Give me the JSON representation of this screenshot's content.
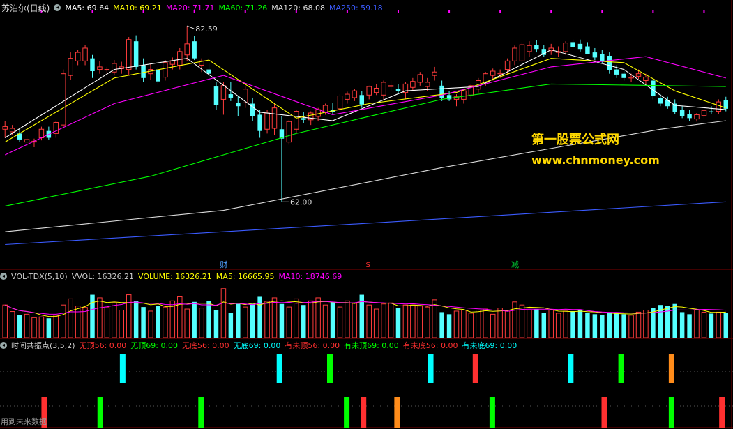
{
  "price_panel": {
    "stock_name": "苏泊尔(日线)",
    "ma_legend": [
      {
        "label": "MA5: 69.64",
        "color": "#ffffff"
      },
      {
        "label": "MA10: 69.21",
        "color": "#ffff00"
      },
      {
        "label": "MA20: 71.71",
        "color": "#ff00ff"
      },
      {
        "label": "MA60: 71.26",
        "color": "#00ff00"
      },
      {
        "label": "MA120: 68.08",
        "color": "#dddddd"
      },
      {
        "label": "MA250: 59.18",
        "color": "#3b5bff"
      }
    ],
    "high_label": "82.59",
    "low_label": "62.00",
    "event_markers": [
      {
        "text": "财",
        "color": "#4fa0ff"
      },
      {
        "text": "$",
        "color": "#ff3030"
      },
      {
        "text": "减",
        "color": "#00cc33"
      }
    ]
  },
  "volume_panel": {
    "indicator_name": "VOL-TDX(5,10)",
    "legend": [
      {
        "label": "VVOL: 16326.21",
        "color": "#cccccc"
      },
      {
        "label": "VOLUME: 16326.21",
        "color": "#ffff00"
      },
      {
        "label": "MA5: 16665.95",
        "color": "#ffff00"
      },
      {
        "label": "MA10: 18746.69",
        "color": "#ff00ff"
      }
    ]
  },
  "signal_panel": {
    "indicator_name": "时间共振点(3,5,2)",
    "legend": [
      {
        "label": "无顶56: 0.00",
        "color": "#ff3030"
      },
      {
        "label": "无顶69: 0.00",
        "color": "#00ff00"
      },
      {
        "label": "无底56: 0.00",
        "color": "#ff3030"
      },
      {
        "label": "无底69: 0.00",
        "color": "#00ffff"
      },
      {
        "label": "有未顶56: 0.00",
        "color": "#ff3030"
      },
      {
        "label": "有未顶69: 0.00",
        "color": "#00ff00"
      },
      {
        "label": "有未底56: 0.00",
        "color": "#ff3030"
      },
      {
        "label": "有未底69: 0.00",
        "color": "#00ffff"
      }
    ],
    "footer_note": "用到未来数据"
  },
  "watermark": {
    "line1": "第一股票公式网",
    "line2": "www.chnmoney.com"
  },
  "colors": {
    "up": "#ff3c3c",
    "down": "#54ffff",
    "background": "#000000",
    "grid": "#800000"
  },
  "chart_data": [
    {
      "type": "candlestick",
      "title": "苏泊尔(日线)",
      "ylim": [
        55,
        84
      ],
      "candles": [
        [
          70.5,
          71.5,
          69.5,
          70.8
        ],
        [
          70.2,
          71.0,
          69.8,
          70.6
        ],
        [
          70.0,
          70.5,
          69.0,
          69.3
        ],
        [
          69.0,
          69.8,
          68.5,
          69.3
        ],
        [
          69.0,
          69.4,
          68.4,
          69.1
        ],
        [
          69.5,
          70.8,
          69.2,
          70.5
        ],
        [
          70.3,
          70.8,
          69.3,
          69.5
        ],
        [
          70.0,
          71.5,
          69.5,
          71.3
        ],
        [
          71.0,
          77.5,
          70.7,
          77.0
        ],
        [
          76.8,
          79.5,
          76.3,
          78.8
        ],
        [
          78.5,
          79.8,
          78.0,
          79.5
        ],
        [
          78.5,
          80.4,
          78.0,
          80.0
        ],
        [
          78.8,
          79.2,
          76.5,
          77.3
        ],
        [
          77.5,
          78.5,
          77.0,
          77.8
        ],
        [
          77.5,
          77.8,
          76.8,
          77.5
        ],
        [
          77.2,
          78.6,
          76.8,
          78.2
        ],
        [
          77.6,
          78.4,
          77.0,
          77.8
        ],
        [
          77.5,
          81.3,
          76.8,
          81.0
        ],
        [
          80.8,
          81.5,
          77.5,
          77.8
        ],
        [
          78.0,
          78.8,
          76.0,
          76.5
        ],
        [
          77.0,
          78.2,
          76.3,
          77.5
        ],
        [
          77.5,
          77.8,
          75.8,
          76.1
        ],
        [
          76.6,
          78.6,
          76.2,
          78.3
        ],
        [
          78.1,
          78.9,
          77.5,
          78.5
        ],
        [
          78.0,
          80.0,
          77.5,
          79.6
        ],
        [
          79.2,
          82.6,
          78.5,
          80.5
        ],
        [
          80.8,
          81.4,
          78.6,
          78.8
        ],
        [
          78.0,
          78.8,
          77.2,
          78.5
        ],
        [
          77.5,
          78.2,
          76.5,
          77.0
        ],
        [
          75.5,
          76.0,
          72.8,
          73.3
        ],
        [
          74.0,
          76.0,
          72.2,
          75.6
        ],
        [
          74.6,
          76.0,
          73.8,
          74.2
        ],
        [
          73.6,
          74.4,
          72.0,
          73.2
        ],
        [
          73.6,
          75.5,
          73.0,
          75.2
        ],
        [
          73.5,
          74.2,
          71.5,
          72.0
        ],
        [
          72.2,
          72.8,
          69.5,
          70.3
        ],
        [
          70.5,
          72.8,
          70.0,
          72.4
        ],
        [
          70.6,
          73.5,
          69.8,
          73.0
        ],
        [
          70.5,
          72.0,
          62.0,
          69.4
        ],
        [
          69.0,
          71.6,
          68.7,
          71.4
        ],
        [
          70.5,
          72.8,
          70.0,
          72.6
        ],
        [
          71.8,
          72.5,
          71.2,
          71.6
        ],
        [
          71.6,
          72.6,
          71.0,
          72.4
        ],
        [
          72.0,
          73.0,
          71.5,
          72.8
        ],
        [
          72.5,
          73.5,
          72.2,
          73.3
        ],
        [
          72.8,
          73.6,
          72.2,
          72.5
        ],
        [
          72.9,
          74.6,
          72.2,
          74.4
        ],
        [
          74.0,
          74.9,
          73.5,
          74.6
        ],
        [
          74.2,
          75.2,
          73.8,
          75.0
        ],
        [
          74.5,
          75.0,
          73.0,
          73.4
        ],
        [
          74.5,
          75.6,
          74.0,
          75.5
        ],
        [
          74.8,
          75.8,
          74.5,
          75.3
        ],
        [
          74.5,
          76.2,
          74.0,
          76.0
        ],
        [
          75.5,
          76.2,
          75.0,
          75.6
        ],
        [
          75.2,
          75.8,
          74.6,
          75.0
        ],
        [
          74.8,
          76.0,
          74.0,
          75.8
        ],
        [
          75.4,
          76.5,
          75.0,
          76.1
        ],
        [
          76.0,
          77.2,
          75.6,
          76.9
        ],
        [
          75.5,
          76.5,
          75.0,
          76.0
        ],
        [
          76.8,
          77.8,
          76.2,
          77.2
        ],
        [
          75.6,
          76.2,
          73.8,
          74.2
        ],
        [
          74.5,
          75.0,
          73.8,
          74.0
        ],
        [
          74.0,
          74.6,
          73.2,
          74.3
        ],
        [
          74.0,
          75.2,
          73.5,
          75.0
        ],
        [
          74.5,
          75.8,
          74.0,
          75.6
        ],
        [
          75.2,
          76.5,
          74.8,
          76.2
        ],
        [
          76.0,
          77.2,
          75.6,
          77.0
        ],
        [
          76.8,
          77.6,
          76.2,
          77.3
        ],
        [
          77.0,
          77.5,
          76.5,
          77.1
        ],
        [
          77.5,
          78.8,
          77.0,
          78.5
        ],
        [
          78.5,
          80.3,
          78.0,
          80.0
        ],
        [
          78.5,
          80.7,
          78.2,
          80.4
        ],
        [
          79.6,
          80.8,
          79.0,
          80.3
        ],
        [
          80.4,
          80.9,
          79.5,
          79.9
        ],
        [
          79.9,
          80.4,
          79.0,
          79.2
        ],
        [
          79.7,
          80.5,
          79.2,
          80.0
        ],
        [
          79.5,
          80.2,
          79.0,
          79.6
        ],
        [
          79.6,
          80.8,
          79.2,
          80.6
        ],
        [
          80.7,
          81.0,
          80.0,
          80.1
        ],
        [
          80.5,
          81.0,
          79.6,
          79.9
        ],
        [
          80.2,
          80.7,
          79.5,
          79.3
        ],
        [
          79.5,
          80.0,
          78.6,
          78.9
        ],
        [
          79.3,
          79.8,
          78.2,
          78.5
        ],
        [
          79.1,
          79.5,
          77.0,
          77.4
        ],
        [
          77.5,
          78.0,
          76.5,
          76.9
        ],
        [
          77.0,
          77.5,
          76.2,
          76.5
        ],
        [
          76.5,
          77.0,
          76.0,
          76.6
        ],
        [
          76.7,
          77.5,
          76.4,
          77.0
        ],
        [
          76.2,
          77.0,
          75.8,
          76.6
        ],
        [
          76.2,
          76.5,
          74.0,
          74.4
        ],
        [
          74.2,
          74.6,
          73.2,
          73.5
        ],
        [
          73.9,
          74.3,
          72.9,
          73.2
        ],
        [
          73.5,
          74.0,
          72.3,
          72.5
        ],
        [
          72.8,
          73.2,
          71.8,
          72.0
        ],
        [
          72.3,
          72.8,
          71.5,
          71.8
        ],
        [
          71.7,
          72.4,
          71.4,
          72.2
        ],
        [
          72.1,
          72.8,
          71.8,
          72.7
        ],
        [
          72.6,
          73.2,
          72.3,
          72.5
        ],
        [
          72.6,
          74.0,
          72.3,
          73.7
        ],
        [
          73.9,
          74.3,
          72.6,
          72.9
        ]
      ],
      "ma": {
        "MA5": [
          [
            0,
            69.5
          ],
          [
            15,
            77.5
          ],
          [
            25,
            78.8
          ],
          [
            35,
            72.5
          ],
          [
            45,
            71.5
          ],
          [
            55,
            75.0
          ],
          [
            65,
            75.5
          ],
          [
            75,
            79.8
          ],
          [
            85,
            77.5
          ],
          [
            92,
            73.3
          ],
          [
            99,
            72.8
          ]
        ],
        "MA10": [
          [
            0,
            69.0
          ],
          [
            15,
            76.5
          ],
          [
            28,
            78.6
          ],
          [
            40,
            71.8
          ],
          [
            50,
            73.5
          ],
          [
            62,
            74.8
          ],
          [
            75,
            78.8
          ],
          [
            85,
            78.3
          ],
          [
            92,
            75.0
          ],
          [
            99,
            73.0
          ]
        ],
        "MA20": [
          [
            0,
            67.5
          ],
          [
            15,
            73.5
          ],
          [
            30,
            76.8
          ],
          [
            45,
            72.2
          ],
          [
            60,
            74.5
          ],
          [
            75,
            77.8
          ],
          [
            88,
            79.0
          ],
          [
            99,
            76.5
          ]
        ],
        "MA60": [
          [
            0,
            61.5
          ],
          [
            20,
            65.0
          ],
          [
            40,
            70.0
          ],
          [
            60,
            74.0
          ],
          [
            75,
            75.8
          ],
          [
            99,
            75.5
          ]
        ],
        "MA120": [
          [
            0,
            58.5
          ],
          [
            30,
            61.0
          ],
          [
            60,
            66.0
          ],
          [
            90,
            70.5
          ],
          [
            99,
            71.5
          ]
        ],
        "MA250": [
          [
            0,
            57.0
          ],
          [
            50,
            59.5
          ],
          [
            99,
            62.0
          ]
        ]
      }
    },
    {
      "type": "bar",
      "title": "VOL-TDX(5,10)",
      "ylim": [
        0,
        27000
      ],
      "values": [
        16000,
        12800,
        11000,
        11500,
        9800,
        10200,
        9500,
        11000,
        16000,
        19000,
        15500,
        14800,
        21000,
        19500,
        15000,
        17000,
        13500,
        21000,
        18000,
        15000,
        13000,
        15500,
        15000,
        18000,
        20000,
        14000,
        17500,
        14500,
        18000,
        13500,
        24000,
        12000,
        16500,
        15000,
        16500,
        20000,
        17800,
        19500,
        16500,
        15000,
        19000,
        16000,
        18000,
        19500,
        16000,
        17500,
        15000,
        18000,
        17000,
        21000,
        16000,
        14000,
        16500,
        17000,
        14500,
        16000,
        16000,
        15500,
        15000,
        18500,
        12500,
        11500,
        13000,
        13500,
        12000,
        13500,
        14000,
        11500,
        14500,
        13000,
        17500,
        16000,
        13500,
        14000,
        12000,
        13500,
        12000,
        13000,
        13000,
        13500,
        12000,
        11500,
        11000,
        12500,
        12000,
        11500,
        11000,
        12500,
        13500,
        14500,
        16000,
        15500,
        16500,
        12500,
        11500,
        13500,
        12500,
        11800,
        12500,
        12200
      ]
    }
  ]
}
